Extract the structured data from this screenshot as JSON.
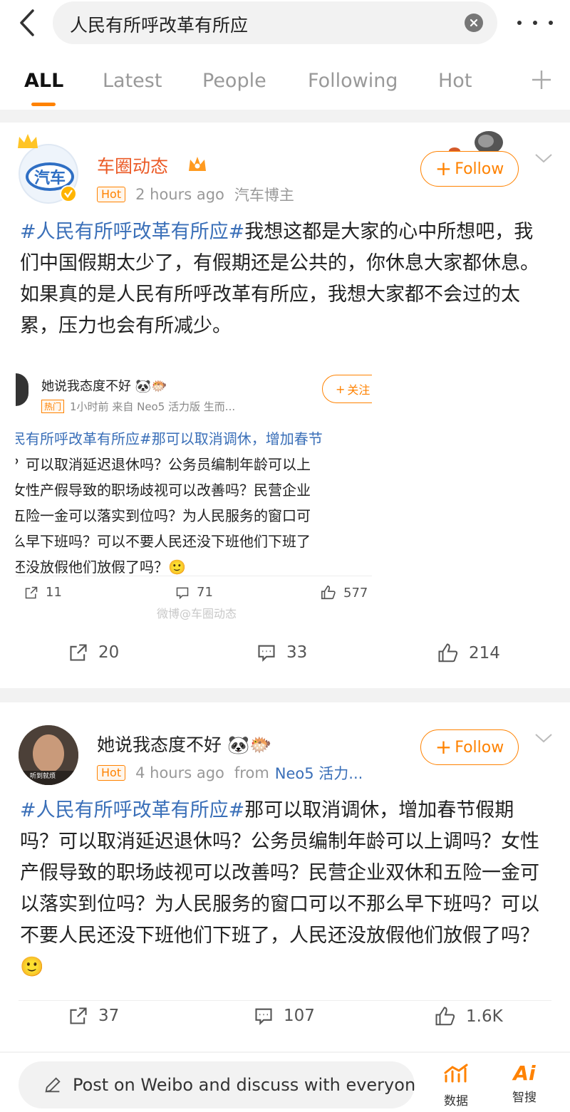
{
  "search": {
    "query": "人民有所呼改革有所应"
  },
  "tabs": [
    "ALL",
    "Latest",
    "People",
    "Following",
    "Hot"
  ],
  "posts": [
    {
      "user": "车圈动态",
      "badge": "Hot",
      "time": "2 hours ago",
      "source": "汽车博主",
      "follow": "Follow",
      "tag": "#人民有所呼改革有所应#",
      "text": "我想这都是大家的心中所想吧，我们中国假期太少了，有假期还是公共的，你休息大家都休息。如果真的是人民有所呼改革有所应，我想大家都不会过的太累，压力也会有所减少。",
      "quote": {
        "user": "她说我态度不好 🐼🐡",
        "badge": "热门",
        "meta": "1小时前  来自 Neo5 活力版 生而...",
        "follow": "关注",
        "lines": [
          "民有所呼改革有所应#那可以取消调休，增加春节",
          "？可以取消延迟退休吗？公务员编制年龄可以上",
          "女性产假导致的职场歧视可以改善吗？民营企业",
          "五险一金可以落实到位吗？为人民服务的窗口可",
          "么早下班吗？可以不要人民还没下班他们下班了",
          "还没放假他们放假了吗？🙂"
        ],
        "reposts": "11",
        "comments": "71",
        "likes": "577",
        "watermark": "微博@车圈动态"
      },
      "reposts": "20",
      "comments": "33",
      "likes": "214"
    },
    {
      "user": "她说我态度不好 🐼🐡",
      "badge": "Hot",
      "time": "4 hours ago",
      "source_prefix": "from",
      "source": "Neo5 活力...",
      "follow": "Follow",
      "tag": "#人民有所呼改革有所应#",
      "text": "那可以取消调休，增加春节假期吗？可以取消延迟退休吗？公务员编制年龄可以上调吗？女性产假导致的职场歧视可以改善吗？民营企业双休和五险一金可以落实到位吗？为人民服务的窗口可以不那么早下班吗？可以不要人民还没下班他们下班了，人民还没放假他们放假了吗？🙂",
      "avatar_caption": "听到就烦",
      "reposts": "37",
      "comments": "107",
      "likes": "1.6K"
    }
  ],
  "bottom": {
    "compose_placeholder": "Post on Weibo and discuss with everyon",
    "data_label": "数据",
    "ai_label": "智搜",
    "ai_icon": "Ai"
  },
  "colors": {
    "accent": "#ff8200",
    "link": "#3a6fb8"
  }
}
